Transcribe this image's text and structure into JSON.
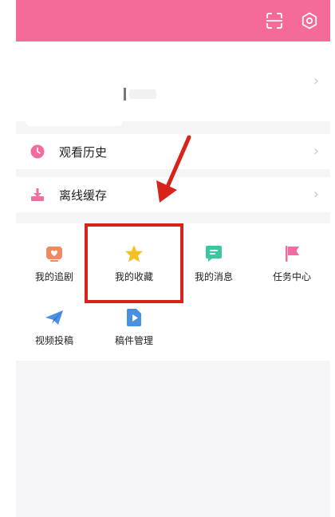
{
  "header": {
    "scan_icon": "scan-icon",
    "settings_icon": "gear-icon"
  },
  "menu": [
    {
      "label": "观看历史",
      "icon": "clock-icon",
      "color": "#f36c9f"
    },
    {
      "label": "离线缓存",
      "icon": "download-icon",
      "color": "#f36c9f"
    }
  ],
  "grid": [
    {
      "label": "我的追剧",
      "icon": "tv-heart-icon",
      "color": "#ef8a5f"
    },
    {
      "label": "我的收藏",
      "icon": "star-icon",
      "color": "#f6c024"
    },
    {
      "label": "我的消息",
      "icon": "message-icon",
      "color": "#3ec6a0"
    },
    {
      "label": "任务中心",
      "icon": "flag-icon",
      "color": "#f26aa0"
    },
    {
      "label": "视频投稿",
      "icon": "paper-plane-icon",
      "color": "#4a90e2"
    },
    {
      "label": "稿件管理",
      "icon": "video-file-icon",
      "color": "#4a90e2"
    }
  ],
  "colors": {
    "header": "#f46b9a",
    "annotation": "#d8231c",
    "background": "#f5f5f7"
  }
}
